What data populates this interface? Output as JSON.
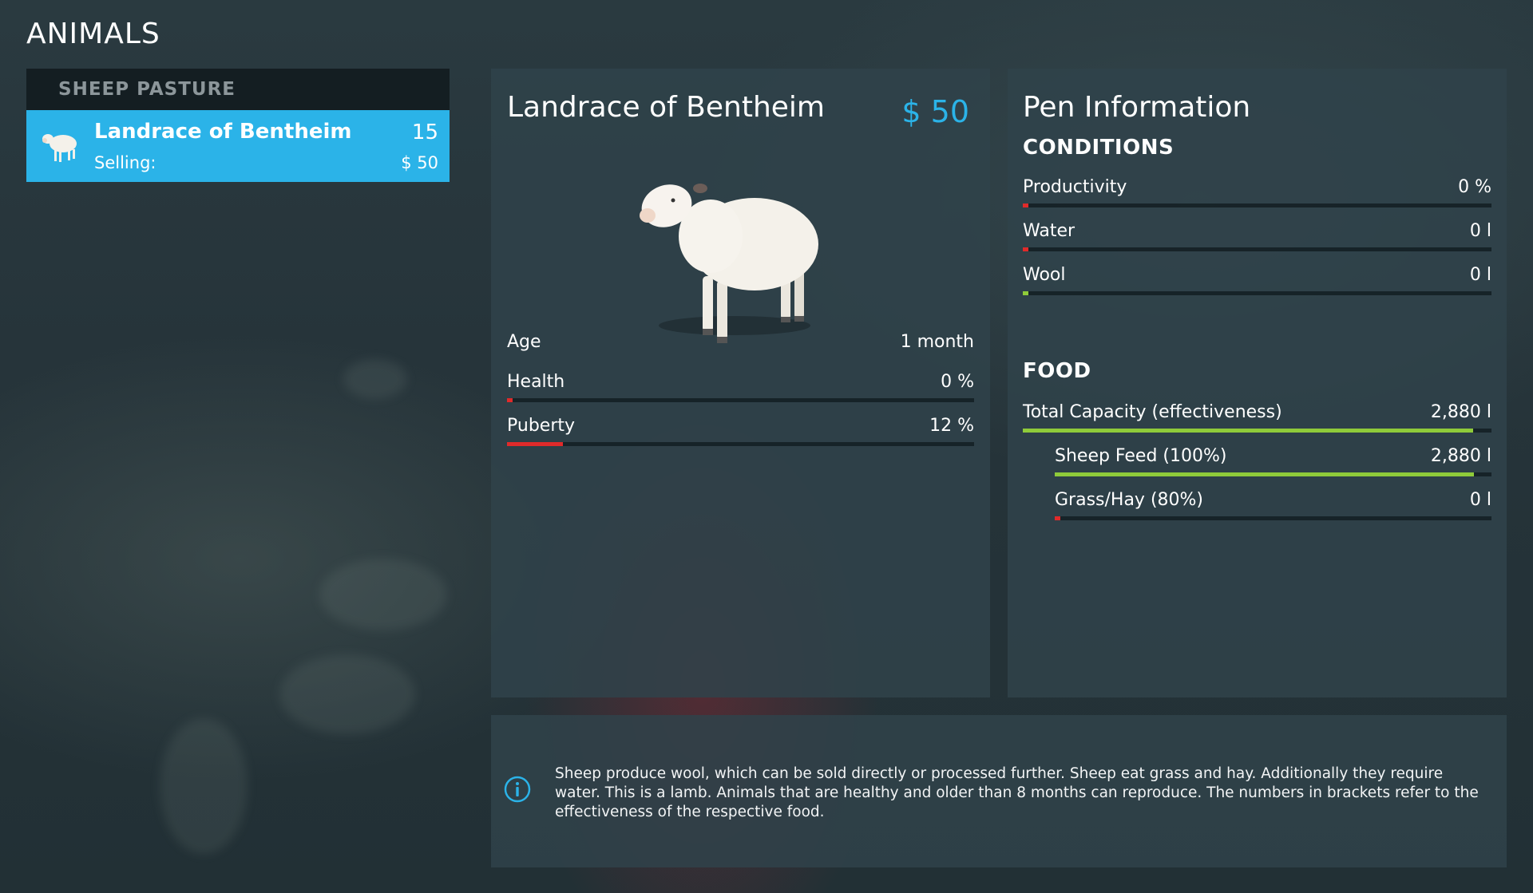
{
  "page": {
    "title": "ANIMALS"
  },
  "sidebar": {
    "header": "SHEEP PASTURE",
    "items": [
      {
        "name": "Landrace of Bentheim",
        "count": "15",
        "selling_label": "Selling:",
        "selling_value": "$ 50",
        "icon": "sheep-icon",
        "selected": true
      }
    ]
  },
  "animal": {
    "name": "Landrace of Bentheim",
    "price": "$ 50",
    "image": "sheep-image",
    "stats": [
      {
        "label": "Age",
        "value": "1 month"
      },
      {
        "label": "Health",
        "value": "0 %",
        "level": 0.0,
        "color": "#e02a2a"
      },
      {
        "label": "Puberty",
        "value": "12 %",
        "level": 0.12,
        "color": "#e02a2a"
      }
    ]
  },
  "pen": {
    "title": "Pen Information",
    "conditions_title": "CONDITIONS",
    "conditions": [
      {
        "label": "Productivity",
        "value": "0 %",
        "level": 0.0,
        "color": "#e02a2a"
      },
      {
        "label": "Water",
        "value": "0 l",
        "level": 0.0,
        "color": "#e02a2a"
      },
      {
        "label": "Wool",
        "value": "0 l",
        "level": 0.0,
        "color": "#8fcb3a"
      }
    ],
    "food_title": "FOOD",
    "food": [
      {
        "label": "Total Capacity (effectiveness)",
        "value": "2,880 l",
        "level": 0.96,
        "color": "#8fcb3a"
      },
      {
        "label": "Sheep Feed (100%)",
        "value": "2,880 l",
        "level": 0.96,
        "color": "#8fcb3a"
      },
      {
        "label": "Grass/Hay (80%)",
        "value": "0 l",
        "level": 0.0,
        "color": "#e02a2a"
      }
    ]
  },
  "info": {
    "icon": "info-icon",
    "text": "Sheep produce wool, which can be sold directly or processed further. Sheep eat grass and hay. Additionally they require water. This is a lamb. Animals that are healthy and older than 8 months can reproduce. The numbers in brackets refer to the effectiveness of the respective food."
  },
  "colors": {
    "accent": "#2bb3e8",
    "bar_red": "#e02a2a",
    "bar_green": "#8fcb3a",
    "panel_bg": "#30424a"
  }
}
